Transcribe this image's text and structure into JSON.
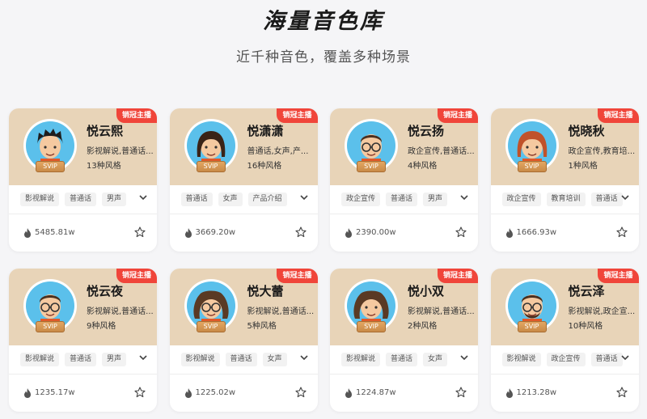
{
  "header": {
    "title": "海量音色库",
    "subtitle": "近千种音色，覆盖多种场景"
  },
  "colors": {
    "card_top": "#e8d4b8",
    "ribbon": "#f0453a",
    "svip_gold": "#d19452",
    "avatar_bg": "#5bc0eb"
  },
  "cards": [
    {
      "name": "悦云熙",
      "ribbon": "销冠主播",
      "badge": "SVIP",
      "tags_line": "影视解说,普通话...",
      "styles": "13种风格",
      "chips": [
        "影视解说",
        "普通话",
        "男声"
      ],
      "count": "5485.81w",
      "avatar": "male-dark-hair-avatar-icon"
    },
    {
      "name": "悦潇潇",
      "ribbon": "销冠主播",
      "badge": "SVIP",
      "tags_line": "普通话,女声,产...",
      "styles": "16种风格",
      "chips": [
        "普通话",
        "女声",
        "产品介绍"
      ],
      "count": "3669.20w",
      "avatar": "female-avatar-icon"
    },
    {
      "name": "悦云扬",
      "ribbon": "销冠主播",
      "badge": "SVIP",
      "tags_line": "政企宣传,普通话...",
      "styles": "4种风格",
      "chips": [
        "政企宣传",
        "普通话",
        "男声"
      ],
      "count": "2390.00w",
      "avatar": "male-glasses-avatar-icon"
    },
    {
      "name": "悦晓秋",
      "ribbon": "销冠主播",
      "badge": "SVIP",
      "tags_line": "政企宣传,教育培...",
      "styles": "1种风格",
      "chips": [
        "政企宣传",
        "教育培训",
        "普通话"
      ],
      "count": "1666.93w",
      "avatar": "female-redhead-avatar-icon"
    },
    {
      "name": "悦云夜",
      "ribbon": "销冠主播",
      "badge": "SVIP",
      "tags_line": "影视解说,普通话...",
      "styles": "9种风格",
      "chips": [
        "影视解说",
        "普通话",
        "男声"
      ],
      "count": "1235.17w",
      "avatar": "male-glasses-avatar-icon"
    },
    {
      "name": "悦大蕾",
      "ribbon": "销冠主播",
      "badge": "SVIP",
      "tags_line": "影视解说,普通话...",
      "styles": "5种风格",
      "chips": [
        "影视解说",
        "普通话",
        "女声"
      ],
      "count": "1225.02w",
      "avatar": "female-curly-glasses-avatar-icon"
    },
    {
      "name": "悦小双",
      "ribbon": "销冠主播",
      "badge": "SVIP",
      "tags_line": "影视解说,普通话...",
      "styles": "2种风格",
      "chips": [
        "影视解说",
        "普通话",
        "女声"
      ],
      "count": "1224.87w",
      "avatar": "female-curly-avatar-icon"
    },
    {
      "name": "悦云泽",
      "ribbon": "销冠主播",
      "badge": "SVIP",
      "tags_line": "影视解说,政企宣...",
      "styles": "10种风格",
      "chips": [
        "影视解说",
        "政企宣传",
        "普通话"
      ],
      "count": "1213.28w",
      "avatar": "male-beard-glasses-avatar-icon"
    }
  ]
}
